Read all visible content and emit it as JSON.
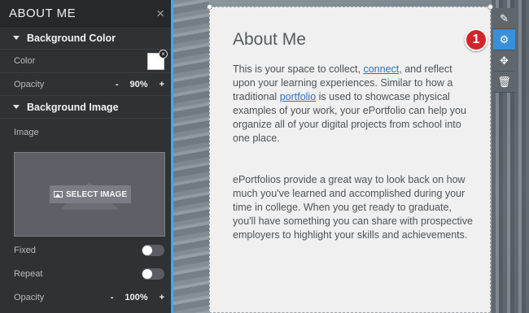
{
  "panel": {
    "title": "ABOUT ME",
    "close_glyph": "×",
    "background_color": {
      "heading": "Background Color",
      "color_label": "Color",
      "color_value": "#ffffff",
      "opacity_label": "Opacity",
      "opacity_value": "90%",
      "minus": "-",
      "plus": "+"
    },
    "background_image": {
      "heading": "Background Image",
      "image_label": "Image",
      "select_button": "SELECT IMAGE",
      "fixed_label": "Fixed",
      "fixed_on": false,
      "repeat_label": "Repeat",
      "repeat_on": false,
      "opacity_label": "Opacity",
      "opacity_value": "100%",
      "minus": "-",
      "plus": "+"
    }
  },
  "card": {
    "title": "About Me",
    "para1_a": "This is your space to collect, ",
    "para1_link1": "connect,",
    "para1_b": " and reflect upon your learning experiences. Similar to how a traditional ",
    "para1_link2": "portfolio",
    "para1_c": " is used to showcase physical examples of your work, your ePortfolio can help you organize all of your digital projects from school into one place.",
    "para2": "ePortfolios provide a great way to look back on how much you've learned and accomplished during your time in college. When you get ready to graduate, you'll have something you can share with prospective employers to highlight your skills and achievements."
  },
  "toolbar": {
    "items": [
      {
        "icon": "edit-icon",
        "glyph": "✎"
      },
      {
        "icon": "gear-icon",
        "glyph": "⚙"
      },
      {
        "icon": "move-icon",
        "glyph": "✥"
      },
      {
        "icon": "trash-icon",
        "glyph": "🗑"
      }
    ],
    "active_index": 1
  },
  "callout_badge": "1",
  "colors": {
    "panel_bg": "#2f3134",
    "accent": "#3a8fd9",
    "link": "#2a72c2",
    "badge": "#d0262b"
  }
}
